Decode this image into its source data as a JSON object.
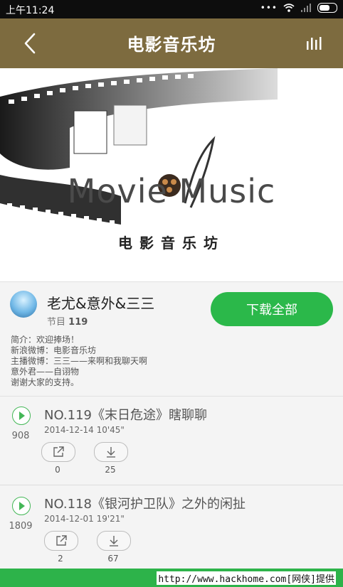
{
  "status_bar": {
    "time": "上午11:24"
  },
  "header": {
    "title": "电影音乐坊"
  },
  "banner": {
    "logo_text": "Movie Music",
    "subtitle": "电影音乐坊"
  },
  "program": {
    "author": "老尤&意外&三三",
    "episodes_label": "节目",
    "episodes_count": "119",
    "download_all_label": "下载全部",
    "description_lines": [
      "简介：欢迎捧场！",
      "新浪微博：电影音乐坊",
      "主播微博：三三——来啊和我聊天啊",
      "意外君——自诩物",
      "谢谢大家的支持。"
    ]
  },
  "episodes": [
    {
      "title": "NO.119《末日危途》瞎聊聊",
      "date": "2014-12-14",
      "duration": "10'45\"",
      "plays": "908",
      "shares": "0",
      "downloads": "25"
    },
    {
      "title": "NO.118《银河护卫队》之外的闲扯",
      "date": "2014-12-01",
      "duration": "19'21\"",
      "plays": "1809",
      "shares": "2",
      "downloads": "67"
    }
  ],
  "watermark": "http://www.hackhome.com[网侠]提供",
  "colors": {
    "header": "#7d6b3f",
    "accent_green": "#2bb84a"
  }
}
